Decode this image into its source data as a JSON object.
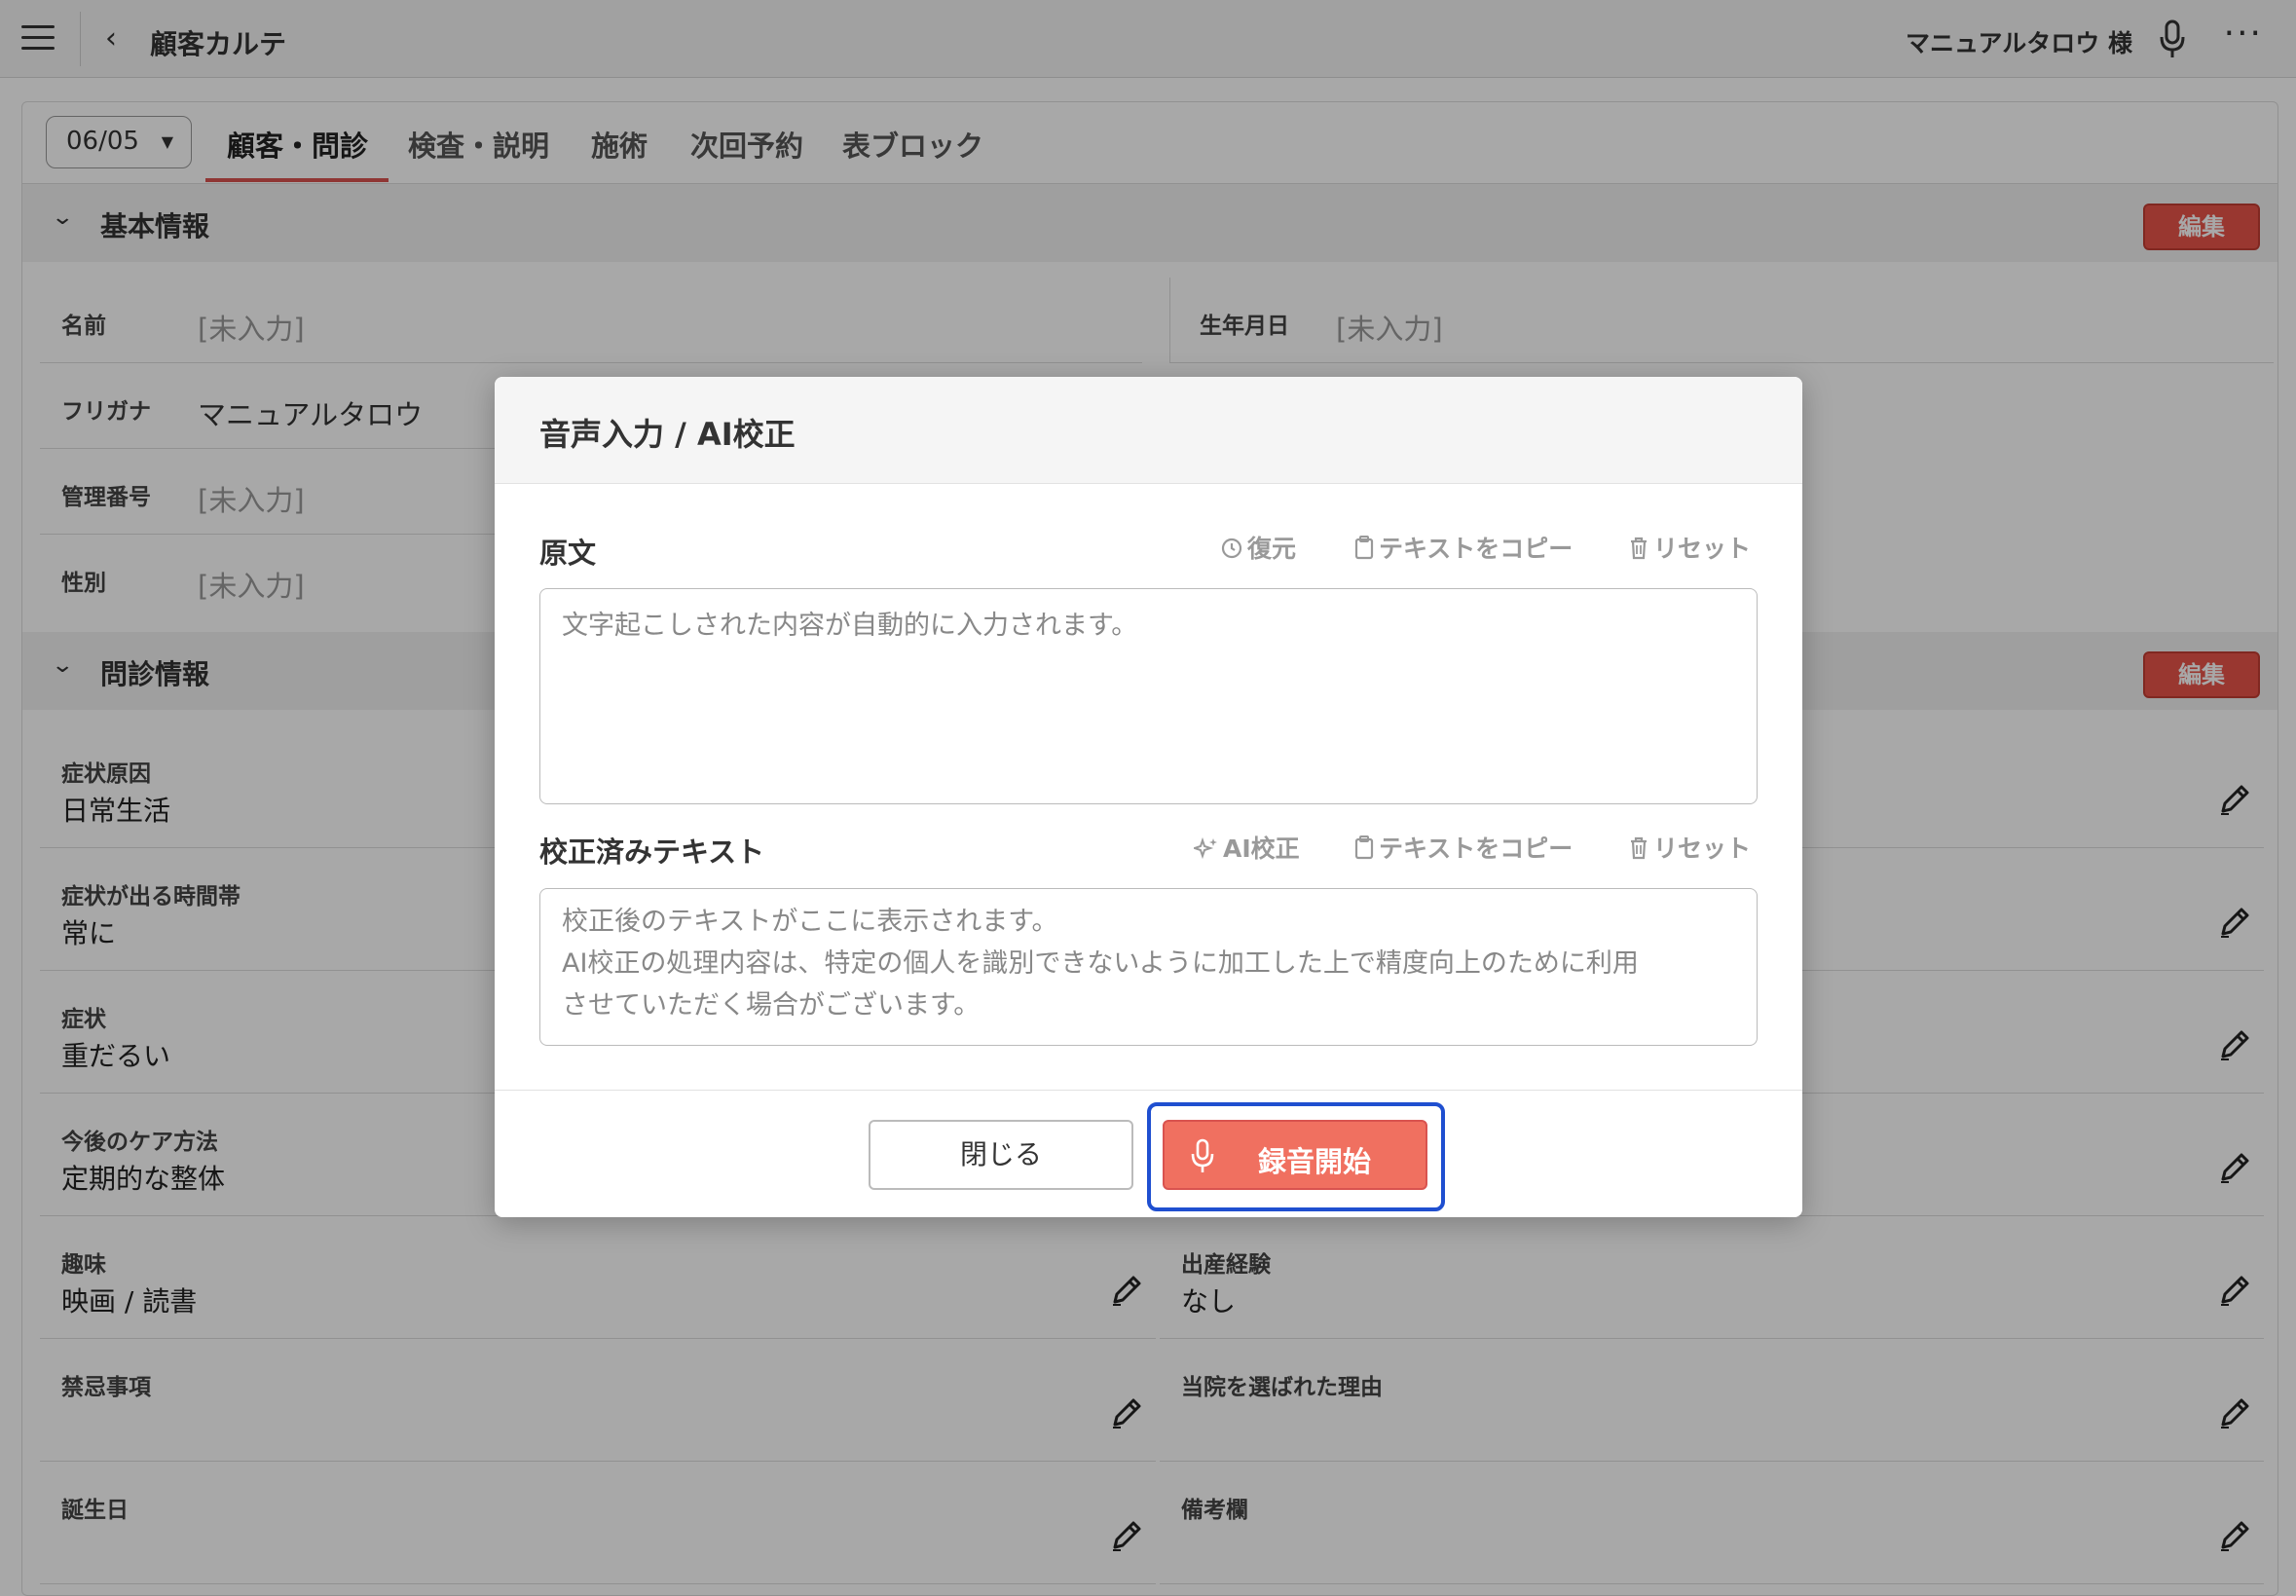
{
  "topbar": {
    "back_icon": "chevron-left-icon",
    "title": "顧客カルテ",
    "user": "マニュアルタロウ 様",
    "more": "···"
  },
  "tabs": {
    "date": "06/05",
    "items": [
      "顧客・問診",
      "検査・説明",
      "施術",
      "次回予約",
      "表ブロック"
    ]
  },
  "basic": {
    "title": "基本情報",
    "edit": "編集",
    "fields": [
      {
        "label": "名前",
        "value": "[未入力]"
      },
      {
        "label": "フリガナ",
        "value": "マニュアルタロウ"
      },
      {
        "label": "管理番号",
        "value": "[未入力]"
      },
      {
        "label": "性別",
        "value": "[未入力]"
      },
      {
        "label": "生年月日",
        "value": "[未入力]"
      }
    ]
  },
  "interview": {
    "title": "問診情報",
    "edit": "編集",
    "left": [
      {
        "label": "症状原因",
        "value": "日常生活"
      },
      {
        "label": "症状が出る時間帯",
        "value": "常に"
      },
      {
        "label": "症状",
        "value": "重だるい"
      },
      {
        "label": "今後のケア方法",
        "value": "定期的な整体"
      },
      {
        "label": "趣味",
        "value": "映画 / 読書"
      },
      {
        "label": "禁忌事項",
        "value": ""
      },
      {
        "label": "誕生日",
        "value": ""
      }
    ],
    "right": [
      {
        "label": "",
        "value": ""
      },
      {
        "label": "",
        "value": ""
      },
      {
        "label": "",
        "value": ""
      },
      {
        "label": "",
        "value": ""
      },
      {
        "label": "出産経験",
        "value": "なし"
      },
      {
        "label": "当院を選ばれた理由",
        "value": ""
      },
      {
        "label": "備考欄",
        "value": ""
      }
    ]
  },
  "modal": {
    "title": "音声入力 / AI校正",
    "original": {
      "label": "原文",
      "restore": "復元",
      "copy": "テキストをコピー",
      "reset": "リセット",
      "placeholder": "文字起こしされた内容が自動的に入力されます。"
    },
    "corrected": {
      "label": "校正済みテキスト",
      "ai": "AI校正",
      "copy": "テキストをコピー",
      "reset": "リセット",
      "line1": "校正後のテキストがここに表示されます。",
      "line2": "AI校正の処理内容は、特定の個人を識別できないように加工した上で精度向上のために利用",
      "line3": "させていただく場合がございます。"
    },
    "close": "閉じる",
    "record": "録音開始"
  },
  "colors": {
    "accent": "#e8544a",
    "record": "#f07060",
    "highlight": "#1f4fd0"
  }
}
